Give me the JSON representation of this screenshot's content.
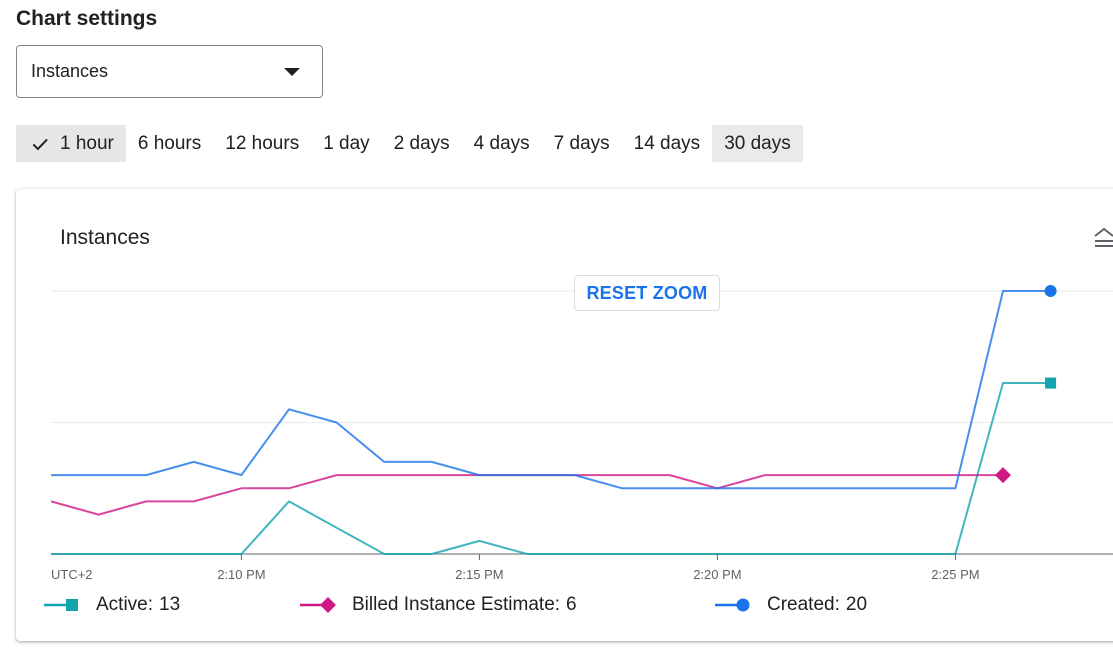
{
  "header": {
    "title": "Chart settings"
  },
  "metric_select": {
    "value": "Instances"
  },
  "time_ranges": [
    {
      "label": "1 hour",
      "selected": true
    },
    {
      "label": "6 hours",
      "selected": false
    },
    {
      "label": "12 hours",
      "selected": false
    },
    {
      "label": "1 day",
      "selected": false
    },
    {
      "label": "2 days",
      "selected": false
    },
    {
      "label": "4 days",
      "selected": false
    },
    {
      "label": "7 days",
      "selected": false
    },
    {
      "label": "14 days",
      "selected": false
    },
    {
      "label": "30 days",
      "selected": false
    }
  ],
  "card": {
    "title": "Instances",
    "reset_zoom_label": "RESET ZOOM"
  },
  "legend": [
    {
      "label": "Active:",
      "value": "13",
      "color": "#12a4af",
      "marker": "square"
    },
    {
      "label": "Billed Instance Estimate:",
      "value": "6",
      "color": "#d01884",
      "marker": "diamond"
    },
    {
      "label": "Created:",
      "value": "20",
      "color": "#1a73e8",
      "marker": "circle"
    }
  ],
  "chart_data": {
    "type": "line",
    "title": "Instances",
    "timezone_label": "UTC+2",
    "x_tick_labels": [
      "2:10 PM",
      "2:15 PM",
      "2:20 PM",
      "2:25 PM"
    ],
    "x_ticks_minutes": [
      10,
      15,
      20,
      25
    ],
    "xlim_minutes": [
      6,
      34
    ],
    "ylim": [
      0,
      20
    ],
    "grid": true,
    "legend_position": "bottom",
    "series": [
      {
        "name": "Active",
        "color": "#12a4af",
        "marker": "square",
        "x": [
          6,
          7,
          8,
          9,
          10,
          11,
          12,
          13,
          14,
          15,
          16,
          17,
          18,
          19,
          20,
          21,
          22,
          23,
          24,
          25,
          26,
          27
        ],
        "y": [
          0,
          0,
          0,
          0,
          0,
          4,
          2,
          0,
          0,
          1,
          0,
          0,
          0,
          0,
          0,
          0,
          0,
          0,
          0,
          0,
          13,
          13
        ]
      },
      {
        "name": "Billed Instance Estimate",
        "color": "#d01884",
        "marker": "diamond",
        "x": [
          6,
          7,
          8,
          9,
          10,
          11,
          12,
          13,
          14,
          15,
          16,
          17,
          18,
          19,
          20,
          21,
          22,
          23,
          24,
          25,
          26
        ],
        "y": [
          4,
          3,
          4,
          4,
          5,
          5,
          6,
          6,
          6,
          6,
          6,
          6,
          6,
          6,
          5,
          6,
          6,
          6,
          6,
          6,
          6
        ]
      },
      {
        "name": "Created",
        "color": "#1a73e8",
        "marker": "circle",
        "x": [
          6,
          7,
          8,
          9,
          10,
          11,
          12,
          13,
          14,
          15,
          16,
          17,
          18,
          19,
          20,
          21,
          22,
          23,
          24,
          25,
          26,
          27
        ],
        "y": [
          6,
          6,
          6,
          7,
          6,
          11,
          10,
          7,
          7,
          6,
          6,
          6,
          5,
          5,
          5,
          5,
          5,
          5,
          5,
          5,
          20,
          20
        ]
      }
    ]
  }
}
